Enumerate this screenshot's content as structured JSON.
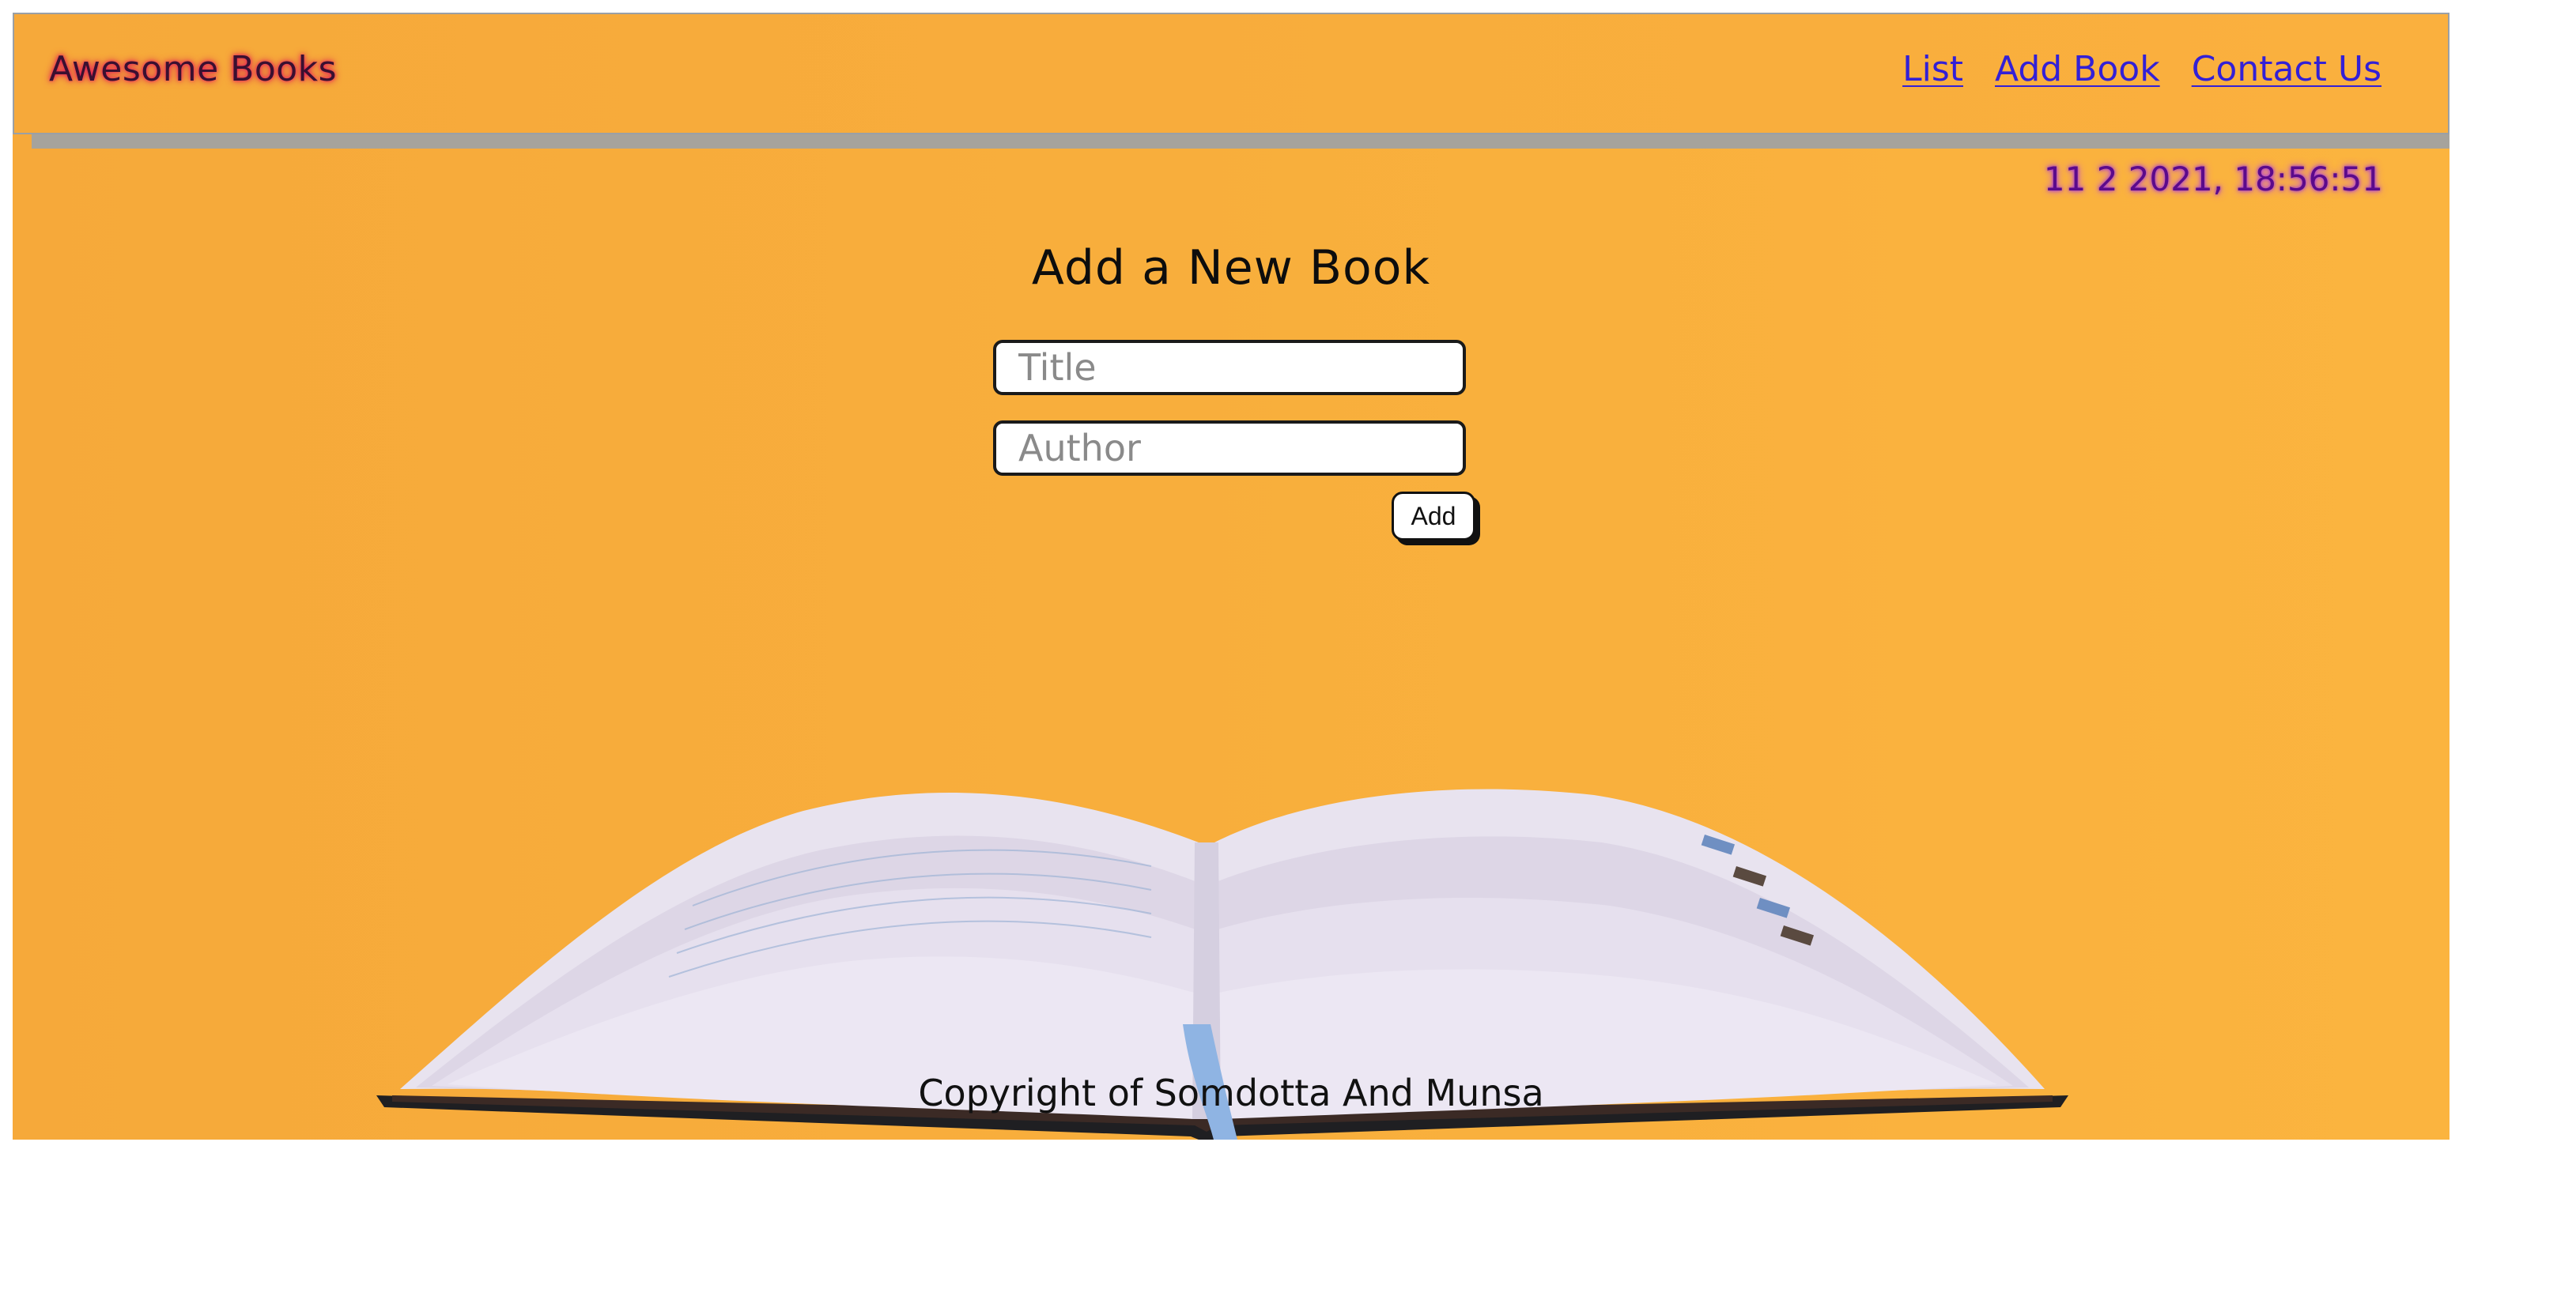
{
  "header": {
    "brand": "Awesome Books",
    "nav": {
      "list": "List",
      "add_book": "Add Book",
      "contact": "Contact Us"
    }
  },
  "datetime": "11 2 2021, 18:56:51",
  "form": {
    "title": "Add a New Book",
    "title_placeholder": "Title",
    "author_placeholder": "Author",
    "add_label": "Add"
  },
  "footer": {
    "copyright": "Copyright of Somdotta And Munsa"
  },
  "colors": {
    "background": "#f8ae3c",
    "brand_text": "#3a1030",
    "nav_link": "#3320d6",
    "datetime": "#5b0a8a"
  },
  "icons": {
    "background_image": "open-book-illustration"
  }
}
